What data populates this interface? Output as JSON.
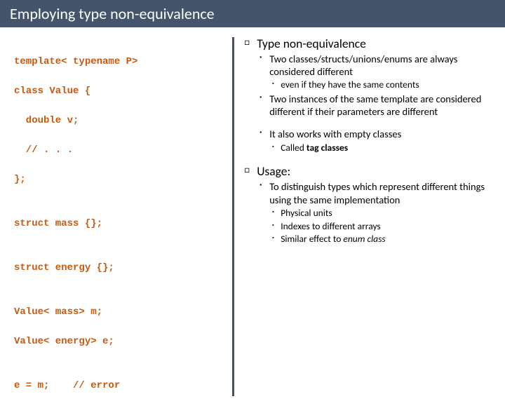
{
  "title": "Employing type non-equivalence",
  "code": {
    "l1": "template< typename P>",
    "l2": "class Value {",
    "l3": "  double v;",
    "l4": "  // . . .",
    "l5": "};",
    "l6": "struct mass {};",
    "l7": "struct energy {};",
    "l8": "Value< mass> m;",
    "l9": "Value< energy> e;",
    "l10": "e = m;    // error"
  },
  "bullets": {
    "h1": "Type non-equivalence",
    "a1": "Two classes/structs/unions/enums are always considered different",
    "a1s": "even if they have the same contents",
    "a2": "Two instances of the same template are considered different if their parameters are different",
    "a3": "It also works with empty classes",
    "a3s_pre": "Called ",
    "a3s_b": "tag classes",
    "h2": "Usage:",
    "b1": "To distinguish types which represent different things using the same implementation",
    "b1s1": "Physical units",
    "b1s2": "Indexes to different arrays",
    "b1s3_pre": "Similar effect to ",
    "b1s3_em": "enum class"
  }
}
